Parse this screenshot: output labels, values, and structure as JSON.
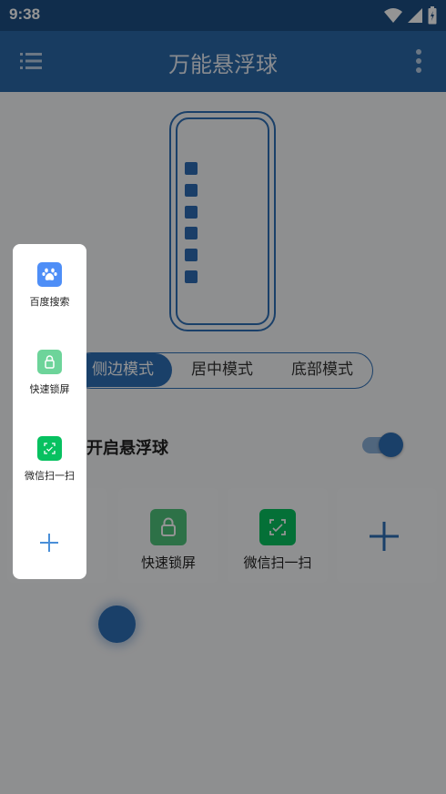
{
  "status_bar": {
    "time": "9:38"
  },
  "app_bar": {
    "title": "万能悬浮球"
  },
  "preview": {
    "dot_count": 6
  },
  "modes": [
    {
      "label": "侧边模式",
      "active": true
    },
    {
      "label": "居中模式",
      "active": false
    },
    {
      "label": "底部模式",
      "active": false
    }
  ],
  "toggle": {
    "label": "开启悬浮球",
    "on": true
  },
  "shortcuts": [
    {
      "label": "快速锁屏",
      "icon": "lock-icon",
      "color": "#4fc37a"
    },
    {
      "label": "微信扫一扫",
      "icon": "scan-icon",
      "color": "#07c160"
    }
  ],
  "panel": {
    "items": [
      {
        "label": "百度搜索",
        "icon": "baidu-paw-icon",
        "color": "#4e8ef7"
      },
      {
        "label": "快速锁屏",
        "icon": "lock-icon",
        "color": "#6dd49a"
      },
      {
        "label": "微信扫一扫",
        "icon": "scan-icon",
        "color": "#07c160"
      }
    ]
  },
  "colors": {
    "primary": "#2e6eb5",
    "app_bar": "#2a68a8",
    "status_bar": "#1c4f83"
  }
}
